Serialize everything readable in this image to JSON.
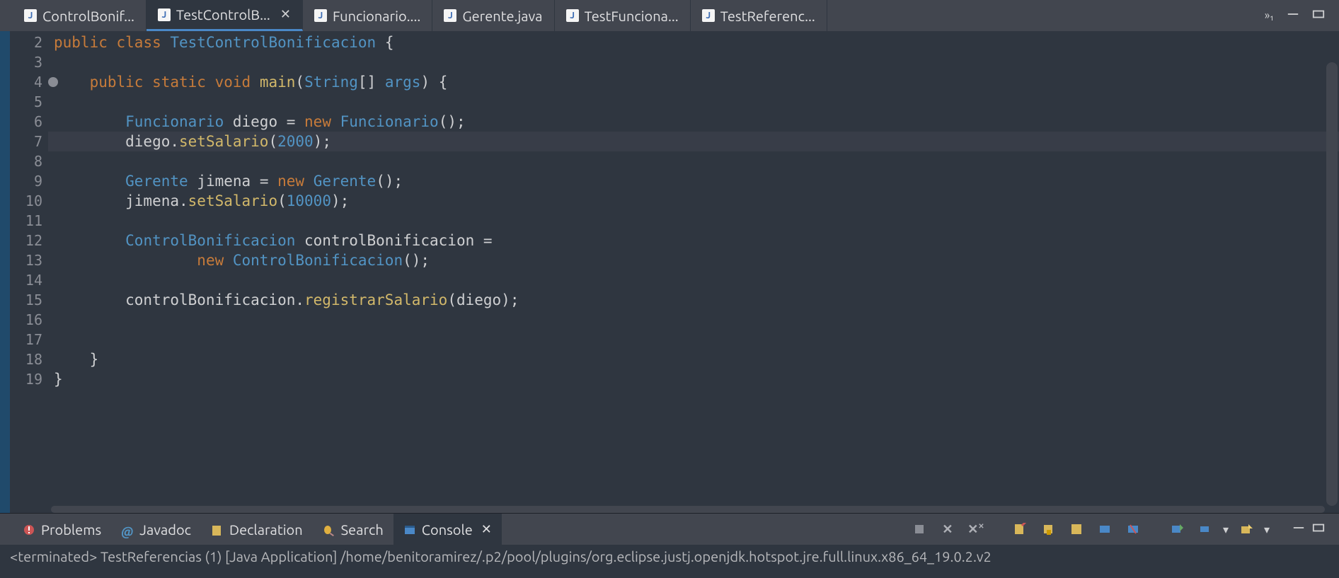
{
  "tabs": [
    {
      "label": "ControlBonif...",
      "active": false,
      "closeable": false
    },
    {
      "label": "TestControlB...",
      "active": true,
      "closeable": true
    },
    {
      "label": "Funcionario....",
      "active": false,
      "closeable": false
    },
    {
      "label": "Gerente.java",
      "active": false,
      "closeable": false
    },
    {
      "label": "TestFunciona...",
      "active": false,
      "closeable": false
    },
    {
      "label": "TestReferenc...",
      "active": false,
      "closeable": false
    }
  ],
  "overflow_indicator": "»₁",
  "editor": {
    "first_line_number": 2,
    "highlighted_line": 7,
    "fold_marker_line": 4,
    "lines": [
      {
        "n": 2,
        "tokens": [
          [
            "k-mod",
            "public "
          ],
          [
            "k-mod",
            "class "
          ],
          [
            "k-type",
            "TestControlBonificacion"
          ],
          [
            "k-ident",
            " {"
          ]
        ]
      },
      {
        "n": 3,
        "tokens": []
      },
      {
        "n": 4,
        "tokens": [
          [
            "k-ident",
            "    "
          ],
          [
            "k-mod",
            "public "
          ],
          [
            "k-mod",
            "static "
          ],
          [
            "k-mod",
            "void "
          ],
          [
            "k-method",
            "main"
          ],
          [
            "k-ident",
            "("
          ],
          [
            "k-type",
            "String"
          ],
          [
            "k-ident",
            "[] "
          ],
          [
            "k-type",
            "args"
          ],
          [
            "k-ident",
            ") {"
          ]
        ]
      },
      {
        "n": 5,
        "tokens": []
      },
      {
        "n": 6,
        "tokens": [
          [
            "k-ident",
            "        "
          ],
          [
            "k-type",
            "Funcionario"
          ],
          [
            "k-ident",
            " diego = "
          ],
          [
            "k-mod",
            "new "
          ],
          [
            "k-type",
            "Funcionario"
          ],
          [
            "k-ident",
            "();"
          ]
        ]
      },
      {
        "n": 7,
        "tokens": [
          [
            "k-ident",
            "        diego."
          ],
          [
            "k-method",
            "setSalario"
          ],
          [
            "k-ident",
            "("
          ],
          [
            "k-num",
            "2000"
          ],
          [
            "k-ident",
            ");"
          ]
        ]
      },
      {
        "n": 8,
        "tokens": []
      },
      {
        "n": 9,
        "tokens": [
          [
            "k-ident",
            "        "
          ],
          [
            "k-type",
            "Gerente"
          ],
          [
            "k-ident",
            " jimena = "
          ],
          [
            "k-mod",
            "new "
          ],
          [
            "k-type",
            "Gerente"
          ],
          [
            "k-ident",
            "();"
          ]
        ]
      },
      {
        "n": 10,
        "tokens": [
          [
            "k-ident",
            "        jimena."
          ],
          [
            "k-method",
            "setSalario"
          ],
          [
            "k-ident",
            "("
          ],
          [
            "k-num",
            "10000"
          ],
          [
            "k-ident",
            ");"
          ]
        ]
      },
      {
        "n": 11,
        "tokens": []
      },
      {
        "n": 12,
        "tokens": [
          [
            "k-ident",
            "        "
          ],
          [
            "k-type",
            "ControlBonificacion"
          ],
          [
            "k-ident",
            " controlBonificacion ="
          ]
        ]
      },
      {
        "n": 13,
        "tokens": [
          [
            "k-ident",
            "                "
          ],
          [
            "k-mod",
            "new "
          ],
          [
            "k-type",
            "ControlBonificacion"
          ],
          [
            "k-ident",
            "();"
          ]
        ]
      },
      {
        "n": 14,
        "tokens": []
      },
      {
        "n": 15,
        "tokens": [
          [
            "k-ident",
            "        controlBonificacion."
          ],
          [
            "k-method",
            "registrarSalario"
          ],
          [
            "k-ident",
            "(diego);"
          ]
        ]
      },
      {
        "n": 16,
        "tokens": []
      },
      {
        "n": 17,
        "tokens": []
      },
      {
        "n": 18,
        "tokens": [
          [
            "k-ident",
            "    }"
          ]
        ]
      },
      {
        "n": 19,
        "tokens": [
          [
            "k-ident",
            "}"
          ]
        ]
      }
    ]
  },
  "views": [
    {
      "label": "Problems",
      "active": false
    },
    {
      "label": "Javadoc",
      "active": false
    },
    {
      "label": "Declaration",
      "active": false
    },
    {
      "label": "Search",
      "active": false
    },
    {
      "label": "Console",
      "active": true
    }
  ],
  "console_status": "<terminated> TestReferencias (1) [Java Application] /home/benitoramirez/.p2/pool/plugins/org.eclipse.justj.openjdk.hotspot.jre.full.linux.x86_64_19.0.2.v2"
}
